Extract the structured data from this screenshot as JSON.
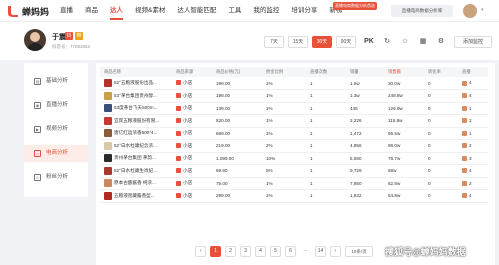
{
  "app": {
    "brand": "蝉妈妈"
  },
  "nav": {
    "items": [
      "直播",
      "商品",
      "达人",
      "视频&素材",
      "达人智能匹配",
      "工具",
      "我的监控",
      "培训分享",
      "新榜"
    ],
    "active_index": 2,
    "promo_badge": "直播电商数据分析首选",
    "top_right_label": "直播电商数据分析库"
  },
  "profile": {
    "name": "于震",
    "id_text": "抖音号：77083652",
    "chips": [
      {
        "color": "#e8503a",
        "text": "抖"
      },
      {
        "color": "#f0a020",
        "text": "带"
      }
    ]
  },
  "range": {
    "buttons": [
      "7天",
      "15天",
      "30天",
      "90天"
    ],
    "active_index": 2
  },
  "header_actions": {
    "pk_label": "PK",
    "monitor_label": "添加监控"
  },
  "sidebar": {
    "items": [
      {
        "label": "基础分析",
        "icon": "chart-icon"
      },
      {
        "label": "直播分析",
        "icon": "live-icon"
      },
      {
        "label": "视频分析",
        "icon": "video-icon"
      },
      {
        "label": "电商分析",
        "icon": "cart-icon"
      },
      {
        "label": "粉丝分析",
        "icon": "fans-icon"
      }
    ],
    "active_index": 3
  },
  "table": {
    "headers": [
      "商品名称",
      "商品来源",
      "商品价格(元)",
      "佣金比例",
      "直播次数",
      "销量",
      "销售额",
      "转化率",
      "直播"
    ],
    "highlight_col": 6,
    "rows": [
      {
        "name": "52°五粮液股份出品...",
        "thumb": "#b8322a",
        "source": "小店",
        "price": "199.00",
        "commission": "1%",
        "lives": "1",
        "sales": "1.5w",
        "revenue": "30.0w",
        "conv": "0",
        "live": "4"
      },
      {
        "name": "53°茅台集团贵州醇...",
        "thumb": "#c9a04a",
        "source": "小店",
        "price": "198.00",
        "commission": "1%",
        "lives": "1",
        "sales": "1.3w",
        "revenue": "248.8w",
        "conv": "0",
        "live": "4"
      },
      {
        "name": "53度茅台飞天500m...",
        "thumb": "#3a4f78",
        "source": "小店",
        "price": "139.00",
        "commission": "1%",
        "lives": "1",
        "sales": "445",
        "revenue": "126.9w",
        "conv": "0",
        "live": "1"
      },
      {
        "name": "宜宾五粮液股份有限...",
        "thumb": "#c43a30",
        "source": "小店",
        "price": "520.00",
        "commission": "1%",
        "lives": "1",
        "sales": "2,226",
        "revenue": "115.8w",
        "conv": "0",
        "live": "2"
      },
      {
        "name": "唐亿红运浓香500*4...",
        "thumb": "#8a5a3a",
        "source": "小店",
        "price": "689.00",
        "commission": "1%",
        "lives": "1",
        "sales": "1,472",
        "revenue": "96.5w",
        "conv": "0",
        "live": "1"
      },
      {
        "name": "52°白水杜康纪念浓...",
        "thumb": "#d8c8a8",
        "source": "小店",
        "price": "219.00",
        "commission": "2%",
        "lives": "1",
        "sales": "4,856",
        "revenue": "96.0w",
        "conv": "0",
        "live": "2"
      },
      {
        "name": "贵州茅台集团 茅韵...",
        "thumb": "#2a2a2a",
        "source": "小店",
        "price": "1,099.00",
        "commission": "10%",
        "lives": "1",
        "sales": "5,580",
        "revenue": "78.7w",
        "conv": "0",
        "live": "3"
      },
      {
        "name": "52°白水杜康生肖纪...",
        "thumb": "#a83a30",
        "source": "小店",
        "price": "69.90",
        "commission": "5%",
        "lives": "1",
        "sales": "9,729",
        "revenue": "68w",
        "conv": "0",
        "live": "4"
      },
      {
        "name": "原本古酿酱香 纯浓...",
        "thumb": "#c98a60",
        "source": "小店",
        "price": "79.00",
        "commission": "1%",
        "lives": "1",
        "sales": "7,950",
        "revenue": "62.8w",
        "conv": "0",
        "live": "2"
      },
      {
        "name": "五粮液窖藏酱香型...",
        "thumb": "#b02a20",
        "source": "小店",
        "price": "299.00",
        "commission": "1%",
        "lives": "1",
        "sales": "1,832",
        "revenue": "54.8w",
        "conv": "0",
        "live": "4"
      }
    ]
  },
  "pager": {
    "pages": [
      "1",
      "2",
      "3",
      "4",
      "5",
      "6",
      "...",
      "14"
    ],
    "active_index": 0,
    "page_size": "10条/页",
    "goto_label": "跳至"
  },
  "watermark": "搜狐号@蝉妈妈数据"
}
